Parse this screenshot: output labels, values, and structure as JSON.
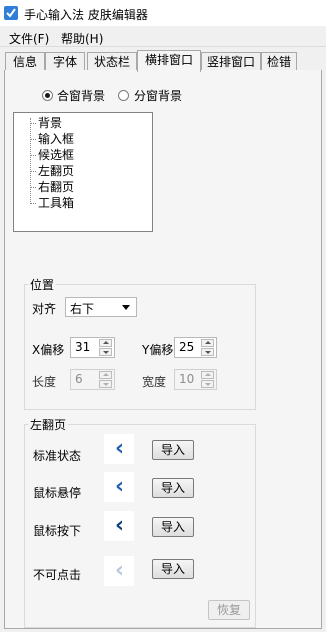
{
  "window": {
    "title": "手心输入法 皮肤编辑器"
  },
  "menu": {
    "file": "文件(F)",
    "help": "帮助(H)"
  },
  "tabs": [
    "信息",
    "字体",
    "状态栏",
    "横排窗口",
    "竖排窗口",
    "检错"
  ],
  "active_tab": "横排窗口",
  "background_mode": {
    "combined": "合窗背景",
    "split": "分窗背景",
    "selected": "合窗背景"
  },
  "tree": [
    "背景",
    "输入框",
    "候选框",
    "左翻页",
    "右翻页",
    "工具箱"
  ],
  "position": {
    "title": "位置",
    "align_label": "对齐",
    "align_value": "右下",
    "x_label": "X偏移",
    "x_value": "31",
    "y_label": "Y偏移",
    "y_value": "25",
    "length_label": "长度",
    "length_value": "6",
    "width_label": "宽度",
    "width_value": "10"
  },
  "left_page": {
    "title": "左翻页",
    "states": [
      {
        "label": "标准状态",
        "import": "导入",
        "arrow_color": "#1c5fb0"
      },
      {
        "label": "鼠标悬停",
        "import": "导入",
        "arrow_color": "#1c5fb0"
      },
      {
        "label": "鼠标按下",
        "import": "导入",
        "arrow_color": "#0f3f7e"
      },
      {
        "label": "不可点击",
        "import": "导入",
        "arrow_color": "#b8c8dc"
      }
    ],
    "restore": "恢复"
  },
  "glyphs": {
    "arrow": "‹"
  }
}
